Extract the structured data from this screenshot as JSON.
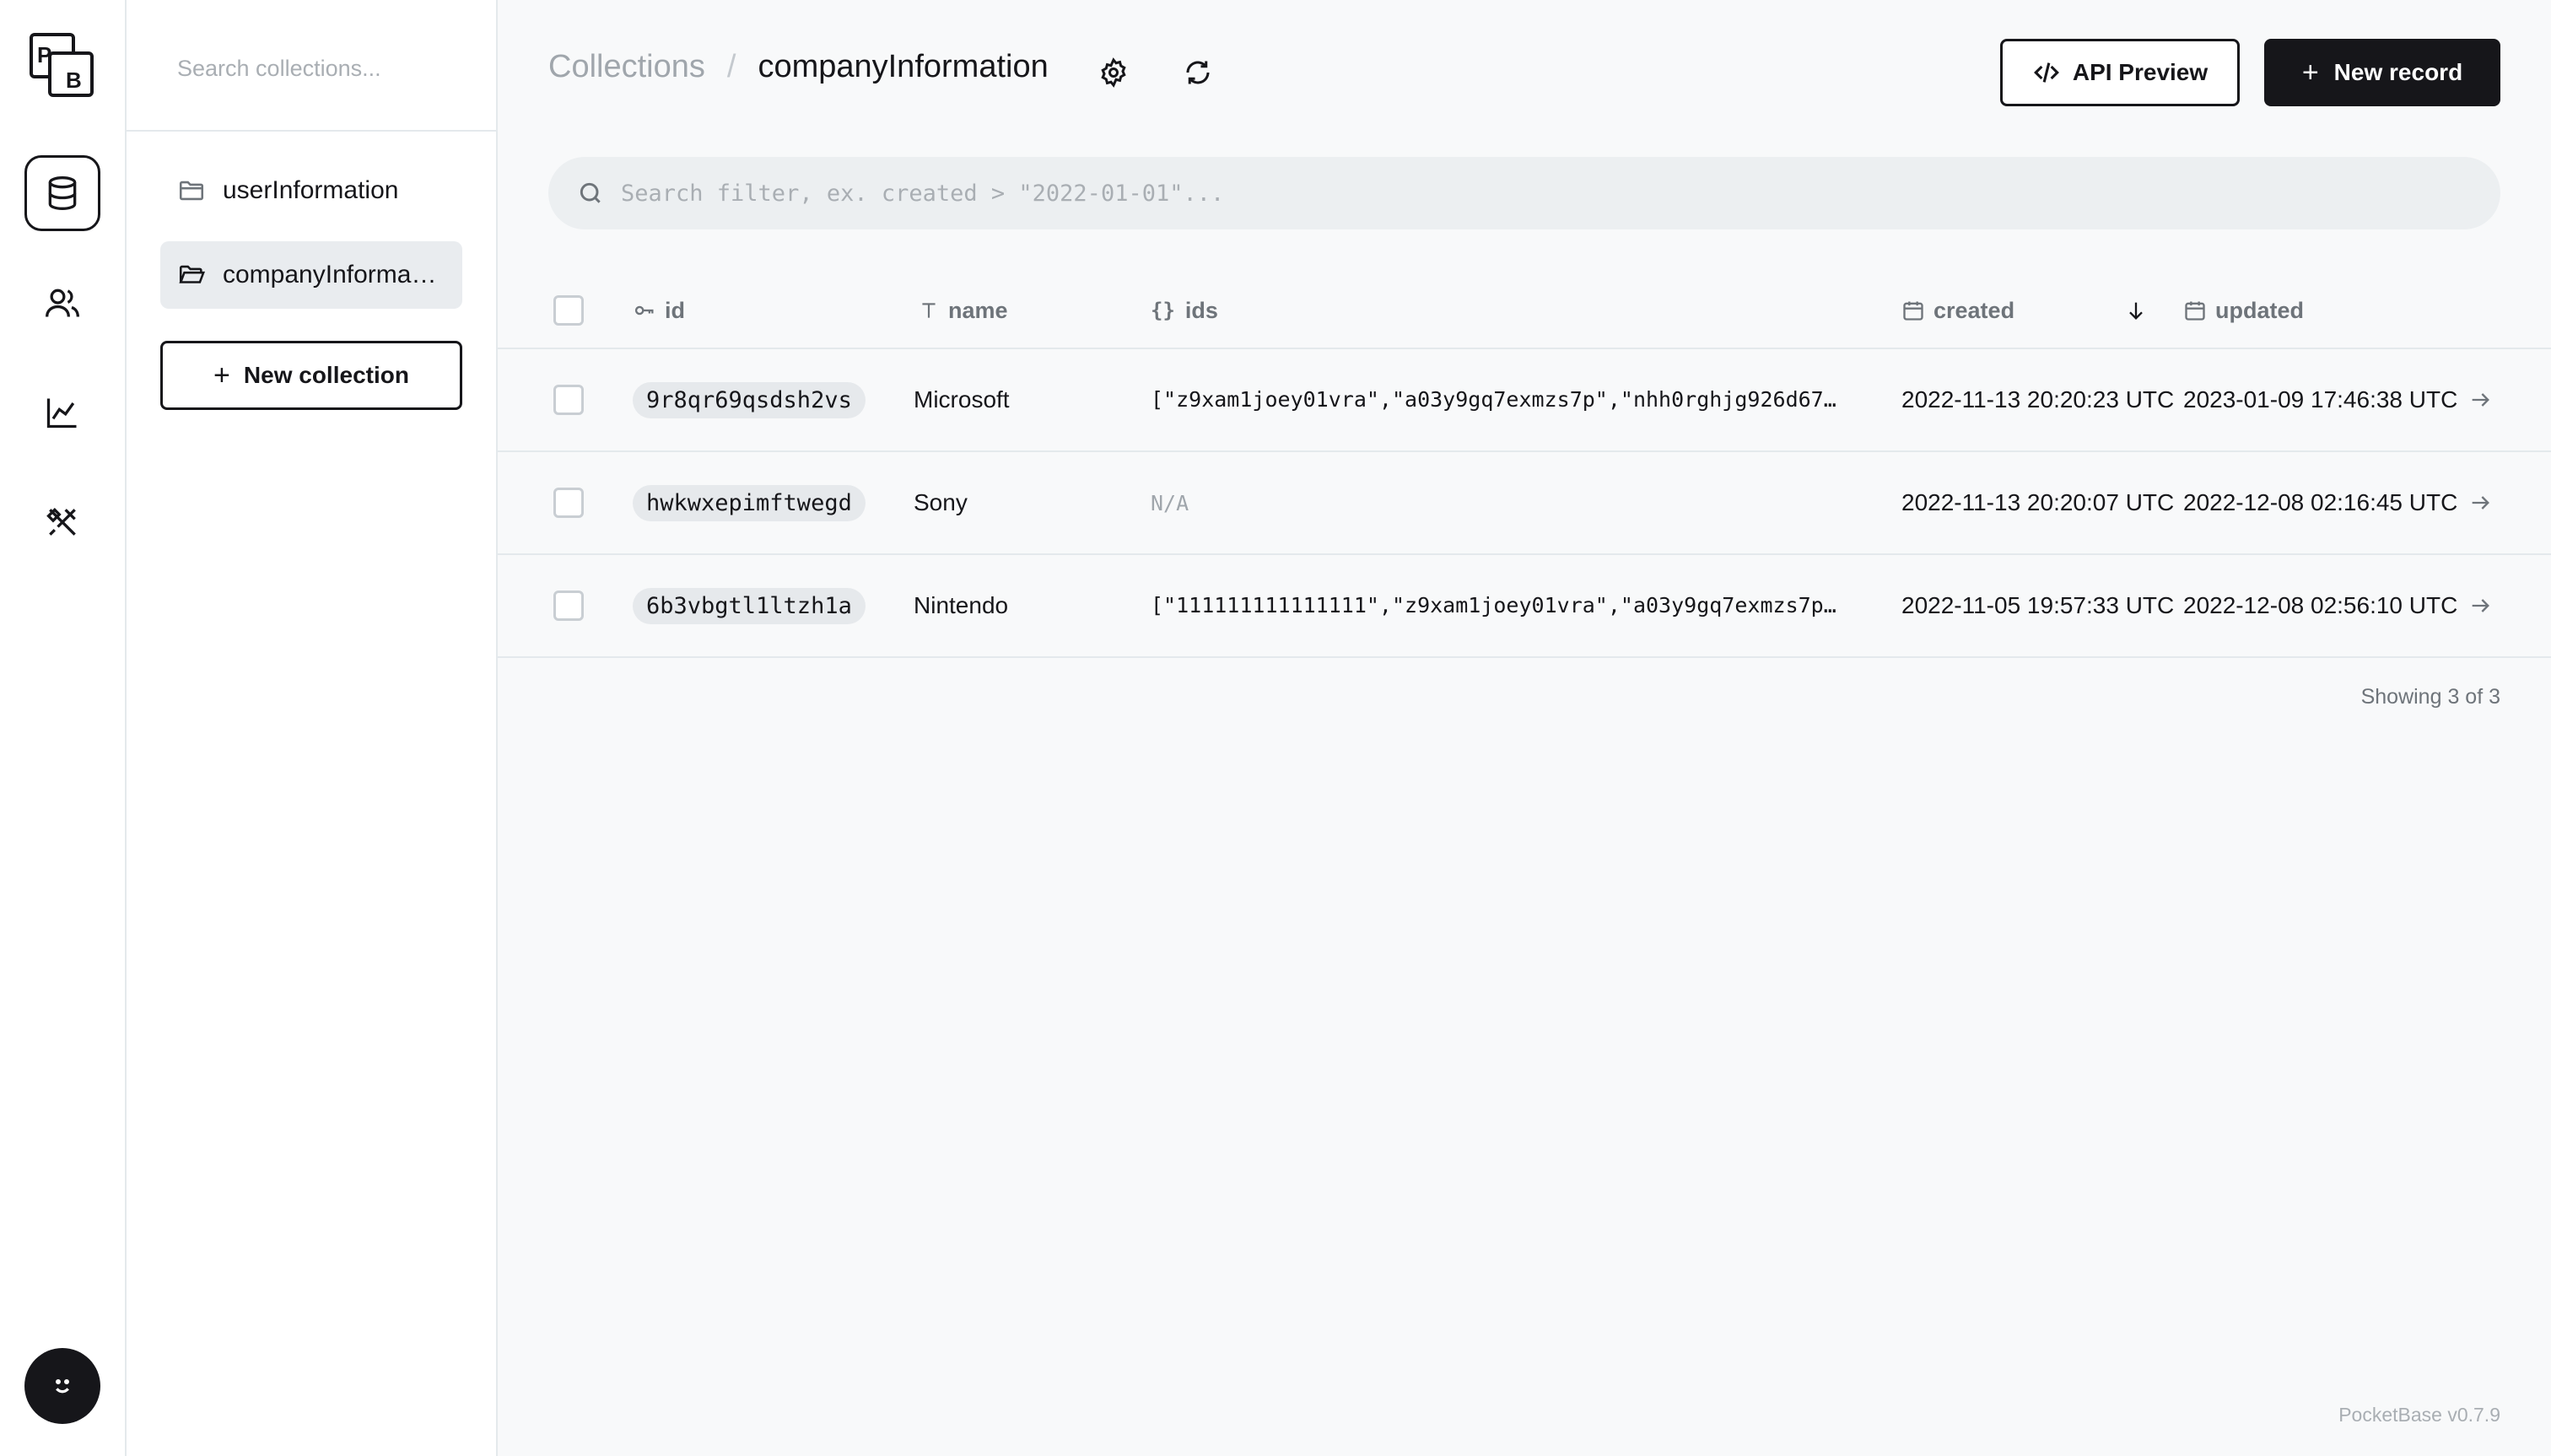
{
  "app": {
    "logo_text": "PB",
    "version": "PocketBase v0.7.9"
  },
  "rail": {
    "items": [
      {
        "name": "collections",
        "icon": "database-icon",
        "active": true
      },
      {
        "name": "users",
        "icon": "users-icon",
        "active": false
      },
      {
        "name": "logs",
        "icon": "chart-line-icon",
        "active": false
      },
      {
        "name": "settings",
        "icon": "tools-icon",
        "active": false
      }
    ]
  },
  "sidebar": {
    "search_placeholder": "Search collections...",
    "collections": [
      {
        "label": "userInformation",
        "icon": "folder-icon",
        "active": false
      },
      {
        "label": "companyInformation",
        "icon": "folder-open-icon",
        "active": true
      }
    ],
    "new_collection_label": "New collection"
  },
  "header": {
    "breadcrumb_root": "Collections",
    "breadcrumb_separator": "/",
    "breadcrumb_current": "companyInformation",
    "api_preview_label": "API Preview",
    "new_record_label": "New record"
  },
  "filter": {
    "placeholder": "Search filter, ex. created > \"2022-01-01\"..."
  },
  "table": {
    "columns": {
      "id": "id",
      "name": "name",
      "ids": "ids",
      "created": "created",
      "updated": "updated"
    },
    "rows": [
      {
        "id": "9r8qr69qsdsh2vs",
        "name": "Microsoft",
        "ids": "[\"z9xam1joey01vra\",\"a03y9gq7exmzs7p\",\"nhh0rghjg926d67…",
        "created": "2022-11-13 20:20:23 UTC",
        "updated": "2023-01-09 17:46:38 UTC"
      },
      {
        "id": "hwkwxepimftwegd",
        "name": "Sony",
        "ids": "N/A",
        "created": "2022-11-13 20:20:07 UTC",
        "updated": "2022-12-08 02:16:45 UTC"
      },
      {
        "id": "6b3vbgtl1ltzh1a",
        "name": "Nintendo",
        "ids": "[\"111111111111111\",\"z9xam1joey01vra\",\"a03y9gq7exmzs7p…",
        "created": "2022-11-05 19:57:33 UTC",
        "updated": "2022-12-08 02:56:10 UTC"
      }
    ],
    "showing_text": "Showing 3 of 3"
  },
  "colors": {
    "text": "#16161a",
    "muted": "#6e747a",
    "border": "#e4e9ec",
    "surface": "#f8f9fa"
  }
}
